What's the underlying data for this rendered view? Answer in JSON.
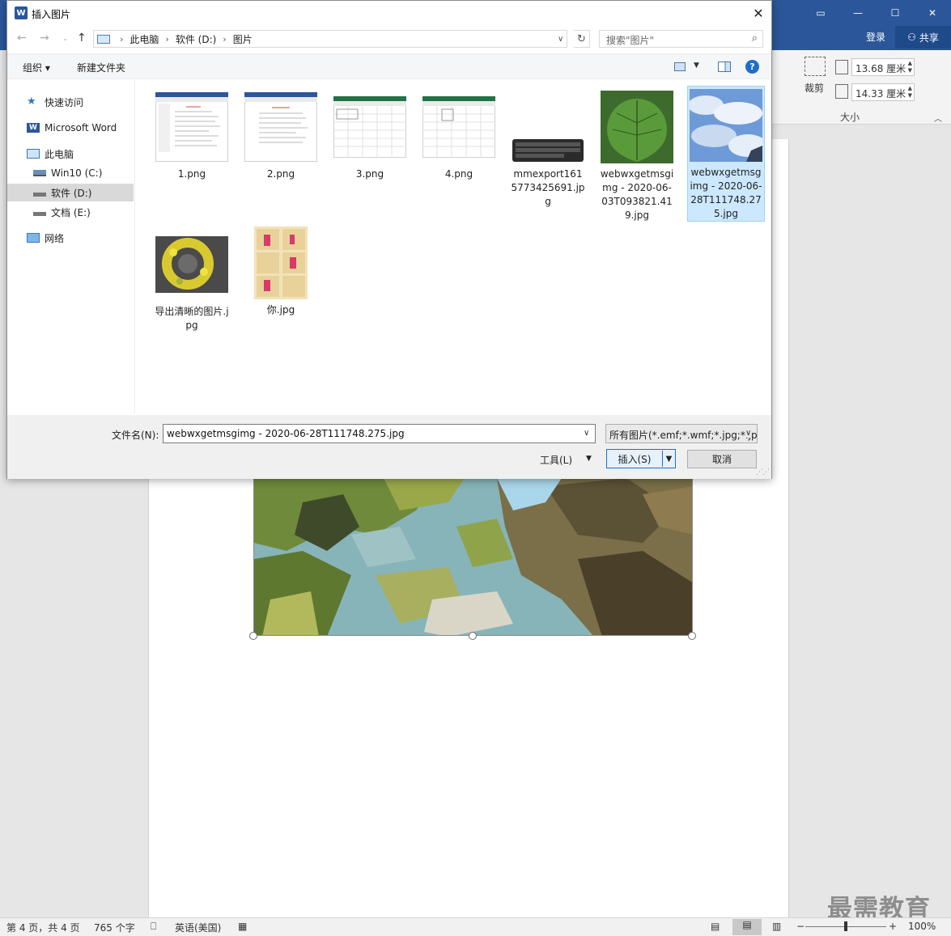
{
  "word": {
    "login": "登录",
    "share": "共享",
    "crop_label": "裁剪",
    "size_label": "大小",
    "height_value": "13.68 厘米",
    "width_value": "14.33 厘米",
    "watermark": "最需教育",
    "status": {
      "page": "第 4 页，共 4 页",
      "words": "765 个字",
      "language": "英语(美国)",
      "zoom": "100%"
    }
  },
  "dialog": {
    "title": "插入图片",
    "close": "✕",
    "breadcrumbs": [
      "此电脑",
      "软件 (D:)",
      "图片"
    ],
    "search_placeholder": "搜索\"图片\"",
    "toolbar": {
      "organize": "组织 ▾",
      "new_folder": "新建文件夹",
      "help": "?"
    },
    "nav": {
      "quick_access": "快速访问",
      "word": "Microsoft Word",
      "this_pc": "此电脑",
      "drive_c": "Win10 (C:)",
      "drive_d": "软件 (D:)",
      "drive_e": "文档 (E:)",
      "network": "网络"
    },
    "files": [
      "1.png",
      "2.png",
      "3.png",
      "4.png",
      "mmexport1615773425691.jpg",
      "webwxgetmsgimg - 2020-06-03T093821.419.jpg",
      "webwxgetmsgimg - 2020-06-28T111748.275.jpg",
      "导出清晰的图片.jpg",
      "你.jpg"
    ],
    "filename_label": "文件名(N):",
    "filename_value": "webwxgetmsgimg - 2020-06-28T111748.275.jpg",
    "filter_value": "所有图片(*.emf;*.wmf;*.jpg;*.jpeg",
    "tools": "工具(L)",
    "insert": "插入(S)",
    "cancel": "取消"
  }
}
